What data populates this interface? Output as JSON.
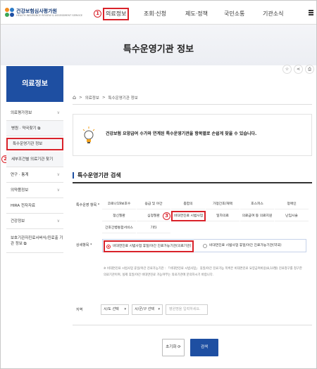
{
  "header": {
    "logo_title": "건강보험심사평가원",
    "logo_sub": "HEALTH INSURANCE REVIEW & ASSESSMENT SERVICE",
    "nav": [
      "의료정보",
      "조회·신청",
      "제도·정책",
      "국민소통",
      "기관소식"
    ],
    "markers": [
      "1",
      "2",
      "3"
    ]
  },
  "banner": {
    "title": "특수운영기관 정보"
  },
  "sidebar": {
    "title": "의료정보",
    "items": [
      {
        "label": "의료평가정보",
        "chev": "∨"
      },
      {
        "label": "병원 · 약국찾기 ⧉",
        "chev": ""
      },
      {
        "label": "특수운영기관 정보",
        "chev": ""
      },
      {
        "label": "세부조건별 의료기관 찾기",
        "chev": ""
      },
      {
        "label": "연구 · 통계",
        "chev": "∨"
      },
      {
        "label": "의약품정보",
        "chev": "∨"
      },
      {
        "label": "HIRA 전자자료",
        "chev": ""
      },
      {
        "label": "건강정보",
        "chev": "∨"
      },
      {
        "label": "보호기관자진료서버식/진료출 기관 정보 ⧉",
        "chev": ""
      }
    ]
  },
  "tools": {
    "star": "☆",
    "share": "⋖",
    "print": "⎙"
  },
  "breadcrumb": {
    "home": "⌂",
    "sep": ">",
    "level1": "의료정보",
    "level2": "특수운영기관 정보"
  },
  "notice": {
    "text": "건강보험 요양급여 수가와 연계된 특수운영기관을 항목별로 손쉽게 찾을 수 있습니다."
  },
  "section": {
    "title": "특수운영기관 검색"
  },
  "form": {
    "type_label": "특수운영 항목 *",
    "types": [
      [
        "코로나19보호수",
        "응급 및 야간",
        "종합의",
        "가정간호/재택",
        "호스피스",
        "정애인"
      ],
      [
        "정신질환",
        "심정질환",
        "비대면진료 시범사업",
        "일차의료",
        "의료급여 등 의료지원",
        "난임시술"
      ],
      [
        "간호간병통합서비스",
        "기타",
        "",
        "",
        "",
        ""
      ]
    ],
    "detail_label": "상세항목 *",
    "detail_options": [
      "비대면진료 시범사업 휴일/야간 진료가능기관(의료기관)",
      "비대면진료 시범사업 휴일/야간 진료가능기관(약국)"
    ],
    "note": "※ 비대면진료 시범사업 휴일/야간 진료가능기관 : 「비대면진료 시범사업」 휴일/야간 진료가능 목록은 비대면진료 요양급여비용(8,10월) 진료청구를 청구한 의료기관이며, 실제 휴일/야간 비대면진료 가능여부는 의료기관에 문의하시기 바랍니다.",
    "region_label": "지역",
    "sido": "시/도 선택",
    "sigungu": "시/군/구 선택",
    "name_placeholder": "병원명을 입력하세요.",
    "reset": "초기화 ⟳",
    "search": "검색"
  },
  "colors": {
    "brand": "#1e4fa2",
    "highlight": "#d9222a"
  }
}
